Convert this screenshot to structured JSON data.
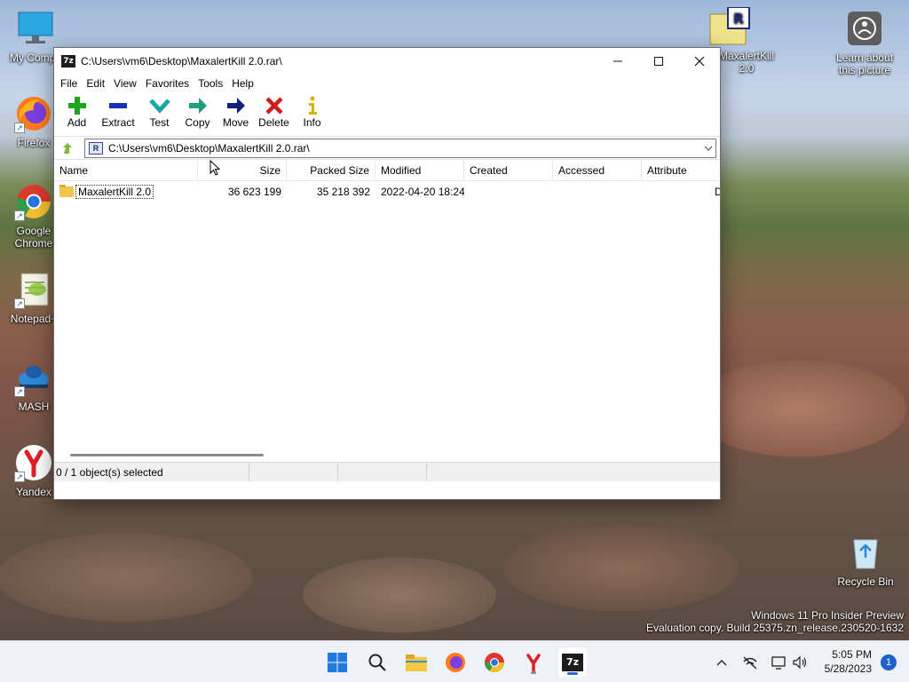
{
  "desktop": {
    "icons": [
      {
        "label": "My Compu"
      },
      {
        "label": "Firefox"
      },
      {
        "label": "Google Chrome"
      },
      {
        "label": "Notepad+"
      },
      {
        "label": "MASH"
      },
      {
        "label": "Yandex"
      }
    ],
    "archive_icon_label": "MaxalertKill 2.0",
    "learn_label": "Learn about this picture",
    "recycle_label": "Recycle Bin"
  },
  "window": {
    "title": "C:\\Users\\vm6\\Desktop\\MaxalertKill 2.0.rar\\",
    "app_icon": "7z",
    "menu": [
      "File",
      "Edit",
      "View",
      "Favorites",
      "Tools",
      "Help"
    ],
    "toolbar": [
      "Add",
      "Extract",
      "Test",
      "Copy",
      "Move",
      "Delete",
      "Info"
    ],
    "address": "C:\\Users\\vm6\\Desktop\\MaxalertKill 2.0.rar\\",
    "address_icon": "R",
    "columns": [
      "Name",
      "Size",
      "Packed Size",
      "Modified",
      "Created",
      "Accessed",
      "Attribute"
    ],
    "rows": [
      {
        "name": "MaxalertKill 2.0",
        "size": "36 623 199",
        "packed": "35 218 392",
        "modified": "2022-04-20 18:24",
        "created": "",
        "accessed": "",
        "attr": "D"
      }
    ],
    "status": "0 / 1 object(s) selected"
  },
  "watermark": {
    "line1": "Windows 11 Pro Insider Preview",
    "line2": "Evaluation copy. Build 25375.zn_release.230520-1632"
  },
  "taskbar": {
    "time": "5:05 PM",
    "date": "5/28/2023",
    "notifications": "1",
    "sevenzip_label": "7z"
  },
  "colors": {
    "accent": "#2b6cd1",
    "add_green": "#1da31d",
    "delete_red": "#d01b1b",
    "folder": "#f2c54c"
  }
}
